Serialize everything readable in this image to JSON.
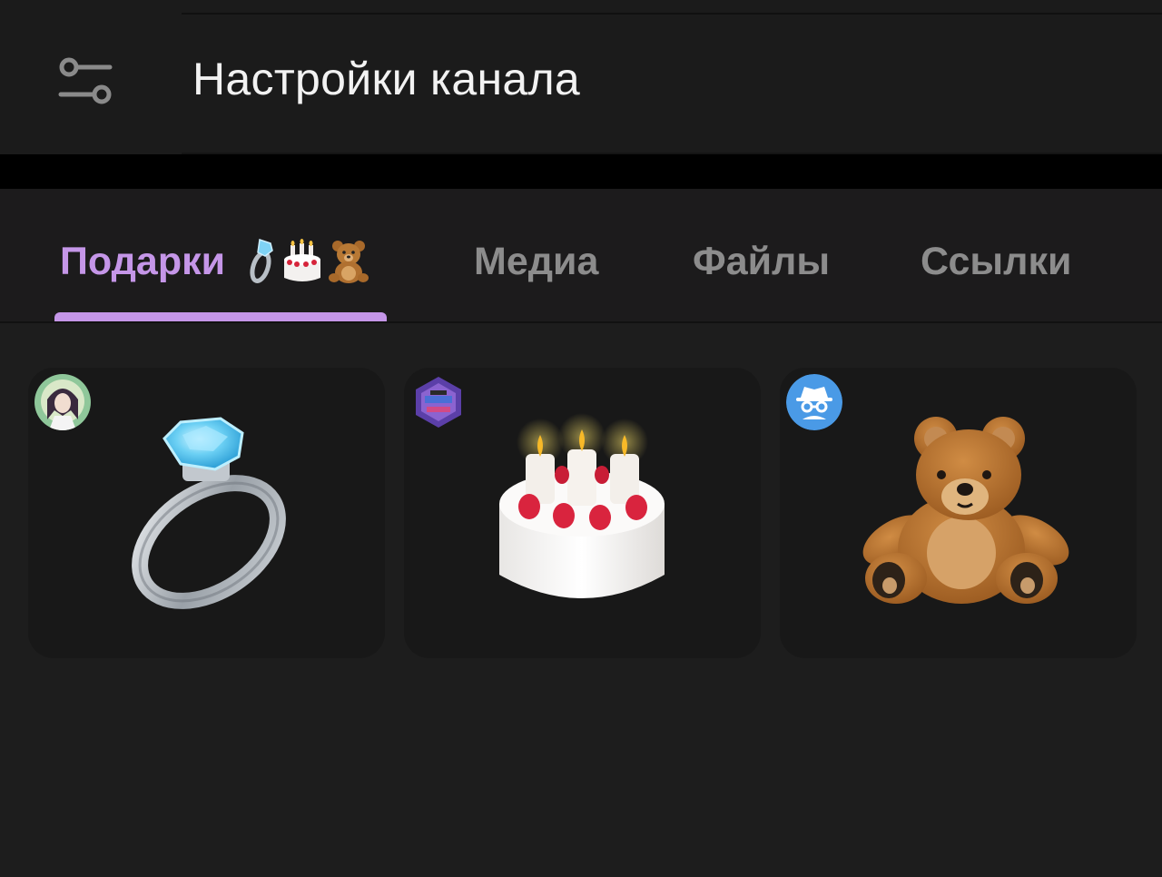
{
  "header": {
    "title": "Настройки канала",
    "settings_icon": "sliders-icon"
  },
  "tabs": [
    {
      "label": "Подарки",
      "active": true,
      "emojis": [
        "ring-icon",
        "cake-icon",
        "teddy-bear-icon"
      ]
    },
    {
      "label": "Медиа",
      "active": false
    },
    {
      "label": "Файлы",
      "active": false
    },
    {
      "label": "Ссылки",
      "active": false
    }
  ],
  "colors": {
    "accent": "#c596e8",
    "background": "#1d1d1d",
    "card": "#181818",
    "inactive_tab": "#8c8c8c"
  },
  "gifts": [
    {
      "gift_icon": "diamond-ring-icon",
      "sender_avatar": "anime-character-avatar"
    },
    {
      "gift_icon": "birthday-cake-icon",
      "sender_avatar": "hexagon-collage-avatar"
    },
    {
      "gift_icon": "teddy-bear-icon",
      "sender_avatar": "incognito-spy-avatar"
    }
  ]
}
